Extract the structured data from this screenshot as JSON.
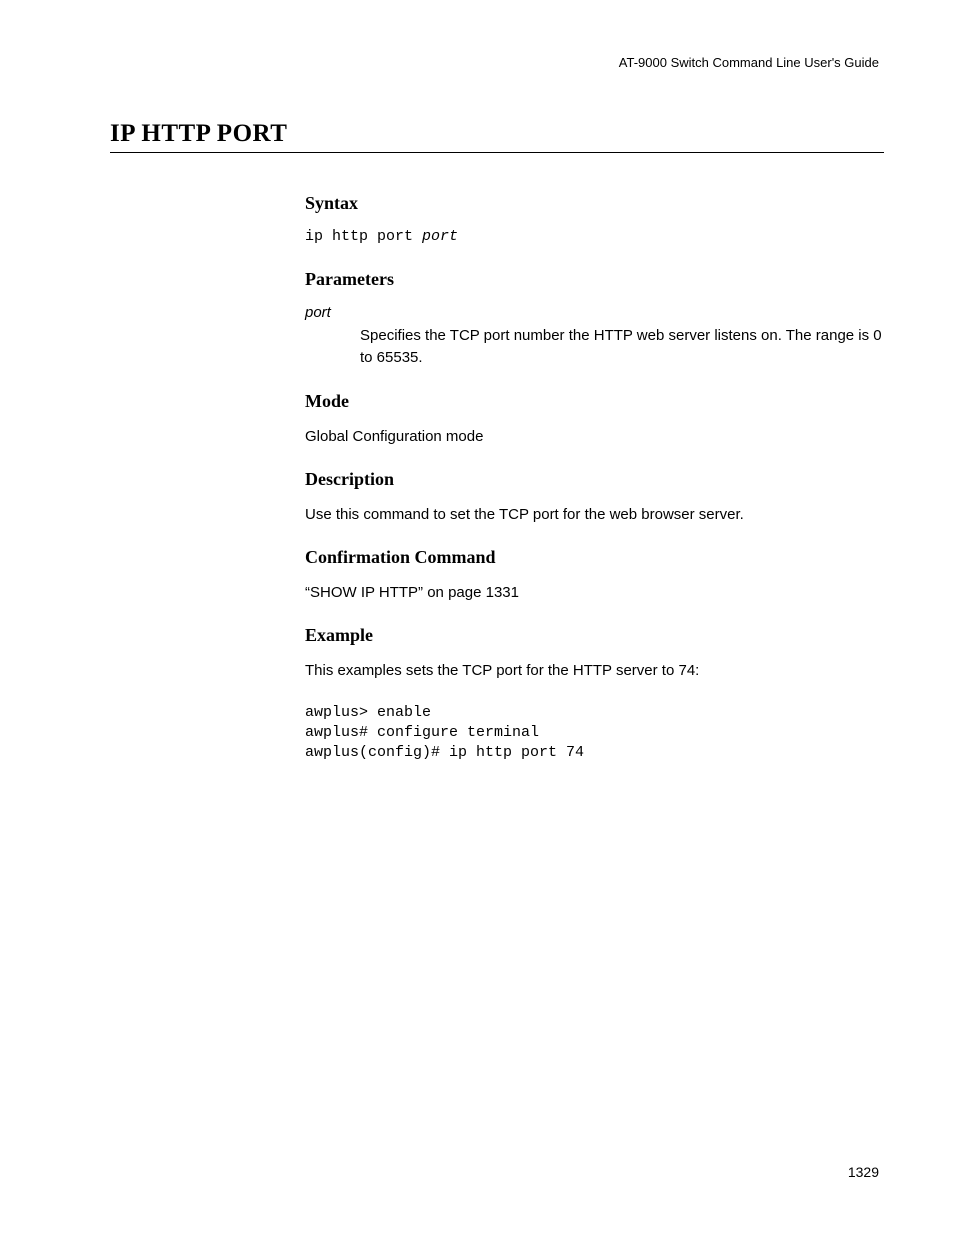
{
  "header": "AT-9000 Switch Command Line User's Guide",
  "title": "IP HTTP PORT",
  "sections": {
    "syntax": {
      "heading": "Syntax",
      "cmd_base": "ip http port ",
      "cmd_param": "port"
    },
    "parameters": {
      "heading": "Parameters",
      "param_name": "port",
      "param_desc": "Specifies the TCP port number the HTTP web server listens on. The range is 0 to 65535."
    },
    "mode": {
      "heading": "Mode",
      "text": "Global Configuration mode"
    },
    "description": {
      "heading": "Description",
      "text": "Use this command to set the TCP port for the web browser server."
    },
    "confirmation": {
      "heading": "Confirmation Command",
      "text": "“SHOW IP HTTP” on page 1331"
    },
    "example": {
      "heading": "Example",
      "intro": "This examples sets the TCP port for the HTTP server to 74:",
      "code": "awplus> enable\nawplus# configure terminal\nawplus(config)# ip http port 74"
    }
  },
  "page_number": "1329"
}
